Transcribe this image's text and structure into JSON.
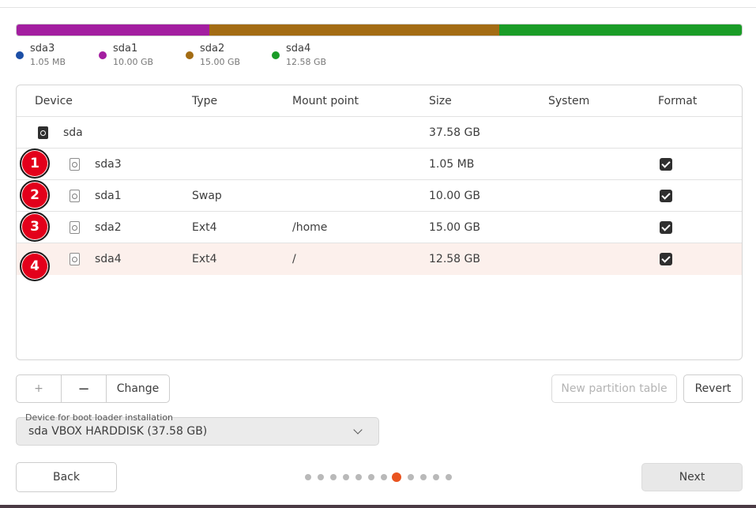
{
  "usage_bar": {
    "segments": [
      {
        "name": "sda3",
        "fraction": 3e-05,
        "color": "#1c5ab5"
      },
      {
        "name": "sda1",
        "fraction": 0.2661,
        "color": "#a31ea0"
      },
      {
        "name": "sda2",
        "fraction": 0.3991,
        "color": "#a36c14"
      },
      {
        "name": "sda4",
        "fraction": 0.3348,
        "color": "#1a9c27"
      }
    ]
  },
  "legend": [
    {
      "name": "sda3",
      "size": "1.05 MB",
      "color": "#1c4fa6"
    },
    {
      "name": "sda1",
      "size": "10.00 GB",
      "color": "#a31ea0"
    },
    {
      "name": "sda2",
      "size": "15.00 GB",
      "color": "#a36c14"
    },
    {
      "name": "sda4",
      "size": "12.58 GB",
      "color": "#1a9c27"
    }
  ],
  "table": {
    "headers": {
      "device": "Device",
      "type": "Type",
      "mount": "Mount point",
      "size": "Size",
      "system": "System",
      "format": "Format"
    },
    "disk": {
      "device": "sda",
      "size": "37.58 GB",
      "icon": "drive-icon"
    },
    "partitions": [
      {
        "marker": "1",
        "device": "sda3",
        "type": "",
        "mount": "",
        "size": "1.05 MB",
        "system": "",
        "format": true
      },
      {
        "marker": "2",
        "device": "sda1",
        "type": "Swap",
        "mount": "",
        "size": "10.00 GB",
        "system": "",
        "format": true
      },
      {
        "marker": "3",
        "device": "sda2",
        "type": "Ext4",
        "mount": "/home",
        "size": "15.00 GB",
        "system": "",
        "format": true
      },
      {
        "marker": "4",
        "device": "sda4",
        "type": "Ext4",
        "mount": "/",
        "size": "12.58 GB",
        "system": "",
        "format": true,
        "selected": true
      }
    ]
  },
  "actions": {
    "add_label": "+",
    "remove_label": "−",
    "change_label": "Change",
    "new_table_label": "New partition table",
    "revert_label": "Revert"
  },
  "bootloader": {
    "label": "Device for boot loader installation",
    "value": "sda VBOX HARDDISK (37.58 GB)"
  },
  "nav": {
    "back_label": "Back",
    "next_label": "Next",
    "steps_total": 12,
    "current_step": 8
  },
  "colors": {
    "accent": "#e95420",
    "marker_red": "#e3001b",
    "selected_row": "#fcf0ec"
  }
}
